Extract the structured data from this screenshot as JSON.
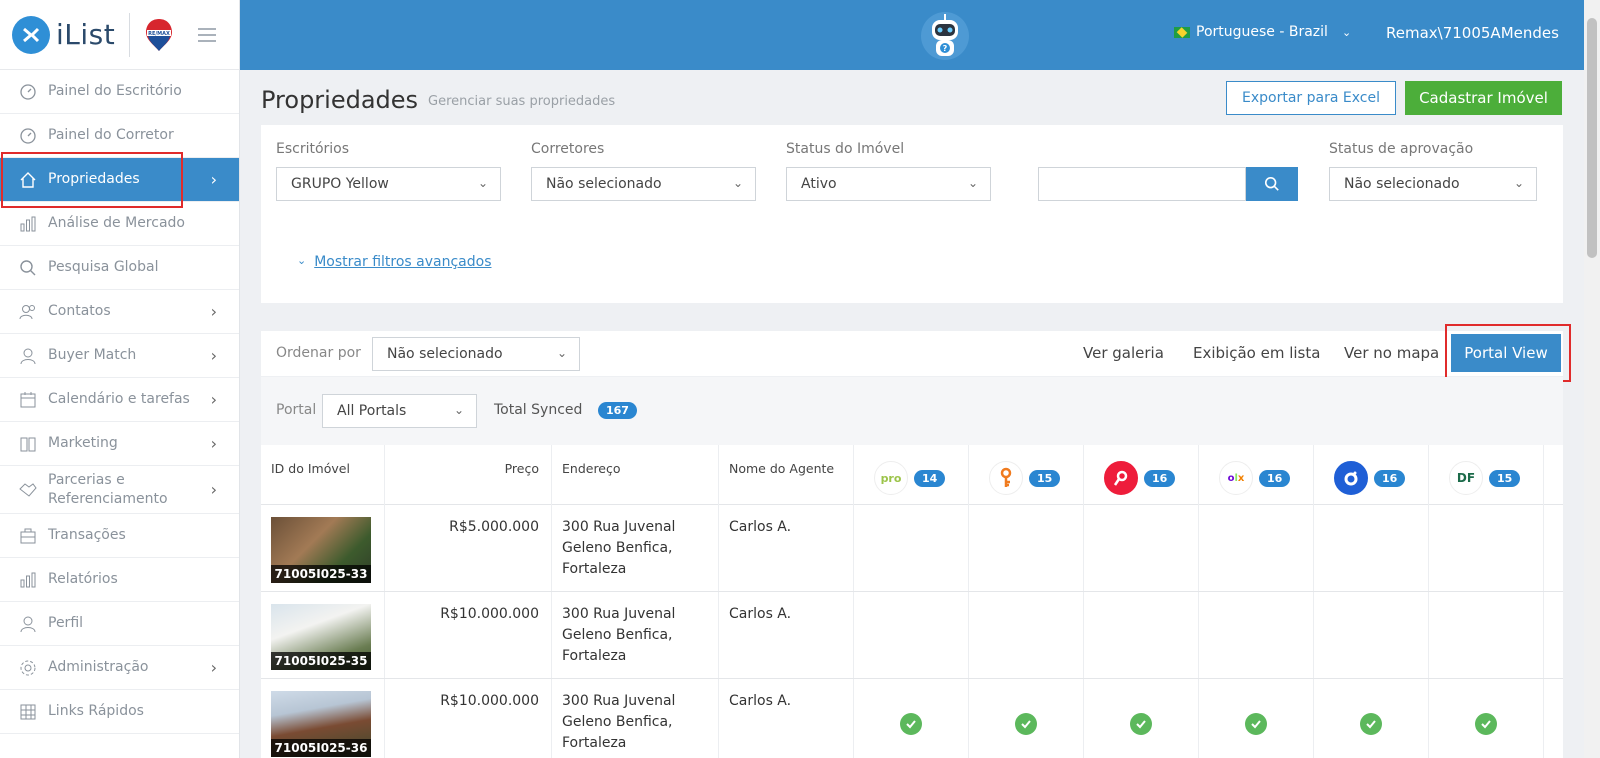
{
  "brand": {
    "name": "iList",
    "partner_logo": "RE/MAX"
  },
  "sidebar": {
    "items": [
      {
        "label": "Painel do Escritório",
        "icon": "gauge-icon"
      },
      {
        "label": "Painel do Corretor",
        "icon": "gauge-icon"
      },
      {
        "label": "Propriedades",
        "icon": "home-icon",
        "active": true
      },
      {
        "label": "Análise de Mercado",
        "icon": "bar-chart-icon"
      },
      {
        "label": "Pesquisa Global",
        "icon": "search-icon"
      },
      {
        "label": "Contatos",
        "icon": "contacts-icon"
      },
      {
        "label": "Buyer Match",
        "icon": "user-icon"
      },
      {
        "label": "Calendário e tarefas",
        "icon": "calendar-icon"
      },
      {
        "label": "Marketing",
        "icon": "book-icon"
      },
      {
        "label": "Parcerias e Referenciamento",
        "icon": "handshake-icon"
      },
      {
        "label": "Transações",
        "icon": "briefcase-icon"
      },
      {
        "label": "Relatórios",
        "icon": "bar-chart-icon"
      },
      {
        "label": "Perfil",
        "icon": "user-icon"
      },
      {
        "label": "Administração",
        "icon": "gear-icon"
      },
      {
        "label": "Links Rápidos",
        "icon": "grid-icon"
      }
    ]
  },
  "topbar": {
    "language": "Portuguese - Brazil",
    "user": "Remax\\71005AMendes"
  },
  "header": {
    "title": "Propriedades",
    "subtitle": "Gerenciar suas propriedades",
    "export_label": "Exportar para Excel",
    "new_label": "Cadastrar Imóvel"
  },
  "filters": {
    "offices_label": "Escritórios",
    "offices_value": "GRUPO Yellow",
    "brokers_label": "Corretores",
    "brokers_value": "Não selecionado",
    "status_label": "Status do Imóvel",
    "status_value": "Ativo",
    "approval_label": "Status de aprovação",
    "approval_value": "Não selecionado",
    "advanced_label": "Mostrar filtros avançados"
  },
  "toolbar": {
    "sort_label": "Ordenar por",
    "sort_value": "Não selecionado",
    "gallery": "Ver galeria",
    "list": "Exibição em lista",
    "map": "Ver no mapa",
    "portal": "Portal View"
  },
  "portal_filter": {
    "label": "Portal",
    "value": "All Portals",
    "total_label": "Total Synced",
    "total_count": "167"
  },
  "table": {
    "headers": {
      "id": "ID do Imóvel",
      "price": "Preço",
      "address": "Endereço",
      "agent": "Nome do Agente"
    },
    "portals": [
      {
        "name": "canal pro",
        "count": "14"
      },
      {
        "name": "chaves",
        "count": "15"
      },
      {
        "name": "imovelweb",
        "count": "16"
      },
      {
        "name": "olx",
        "count": "16"
      },
      {
        "name": "zap",
        "count": "16"
      },
      {
        "name": "df imoveis",
        "count": "15"
      }
    ],
    "rows": [
      {
        "id": "71005I025-33",
        "price": "R$5.000.000",
        "address": "300 Rua Juvenal Geleno Benfica, Fortaleza",
        "agent": "Carlos A.",
        "synced": [
          false,
          false,
          false,
          false,
          false,
          false
        ]
      },
      {
        "id": "71005I025-35",
        "price": "R$10.000.000",
        "address": "300 Rua Juvenal Geleno Benfica, Fortaleza",
        "agent": "Carlos A.",
        "synced": [
          false,
          false,
          false,
          false,
          false,
          false
        ]
      },
      {
        "id": "71005I025-36",
        "price": "R$10.000.000",
        "address": "300 Rua Juvenal Geleno Benfica, Fortaleza",
        "agent": "Carlos A.",
        "synced": [
          true,
          true,
          true,
          true,
          true,
          true
        ]
      }
    ]
  },
  "colors": {
    "primary": "#3a8bc9",
    "success": "#4cae3a",
    "highlight": "#e02b2b"
  }
}
